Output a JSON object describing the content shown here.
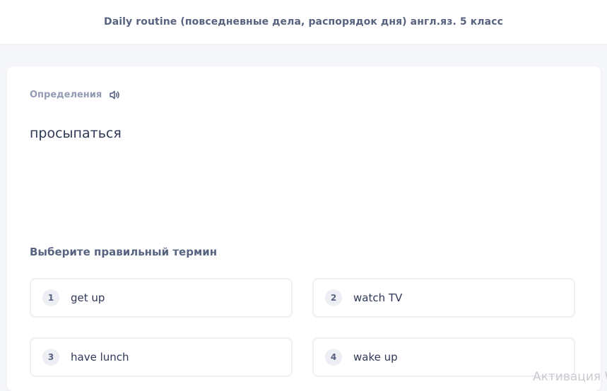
{
  "header": {
    "title": "Daily routine (повседневные дела, распорядок дня) англ.яз. 5 класс"
  },
  "card": {
    "section_label": "Определения",
    "speaker_icon": "speaker-icon",
    "definition": "просыпаться",
    "prompt": "Выберите правильный термин",
    "options": [
      {
        "number": "1",
        "text": "get up"
      },
      {
        "number": "2",
        "text": "watch TV"
      },
      {
        "number": "3",
        "text": "have lunch"
      },
      {
        "number": "4",
        "text": "wake up"
      }
    ]
  },
  "watermark": "Активация W",
  "colors": {
    "background": "#f6f7fb",
    "title": "#586380",
    "label": "#939bb4",
    "text": "#2e3856",
    "border": "#edeff4"
  }
}
